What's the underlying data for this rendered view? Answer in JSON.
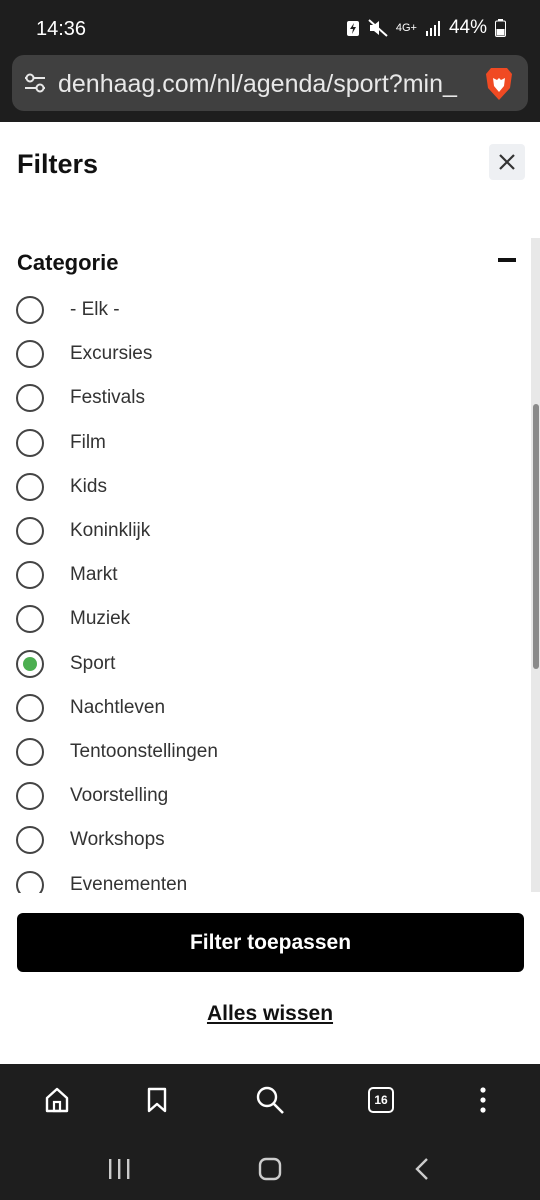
{
  "status_bar": {
    "time": "14:36",
    "network": "4G+",
    "battery": "44%",
    "icons": [
      "battery-saver-icon",
      "mute-icon",
      "network-icon",
      "signal-icon",
      "battery-icon"
    ]
  },
  "browser": {
    "url": "denhaag.com/nl/agenda/sport?min_",
    "icons": [
      "site-settings-icon",
      "brave-lion-icon"
    ],
    "tab_count": "16",
    "toolbar_icons": [
      "home-icon",
      "bookmark-icon",
      "search-icon",
      "tabs-icon",
      "more-icon"
    ]
  },
  "filters": {
    "title": "Filters",
    "category_heading": "Categorie",
    "options": [
      {
        "label": "- Elk -",
        "checked": false
      },
      {
        "label": "Excursies",
        "checked": false
      },
      {
        "label": "Festivals",
        "checked": false
      },
      {
        "label": "Film",
        "checked": false
      },
      {
        "label": "Kids",
        "checked": false
      },
      {
        "label": "Koninklijk",
        "checked": false
      },
      {
        "label": "Markt",
        "checked": false
      },
      {
        "label": "Muziek",
        "checked": false
      },
      {
        "label": "Sport",
        "checked": true
      },
      {
        "label": "Nachtleven",
        "checked": false
      },
      {
        "label": "Tentoonstellingen",
        "checked": false
      },
      {
        "label": "Voorstelling",
        "checked": false
      },
      {
        "label": "Workshops",
        "checked": false
      },
      {
        "label": "Evenementen",
        "checked": false
      }
    ],
    "apply_label": "Filter toepassen",
    "clear_label": "Alles wissen",
    "accent_color": "#4caf50"
  },
  "nav_bar": {
    "icons": [
      "recent-apps-icon",
      "home-nav-icon",
      "back-icon"
    ]
  }
}
